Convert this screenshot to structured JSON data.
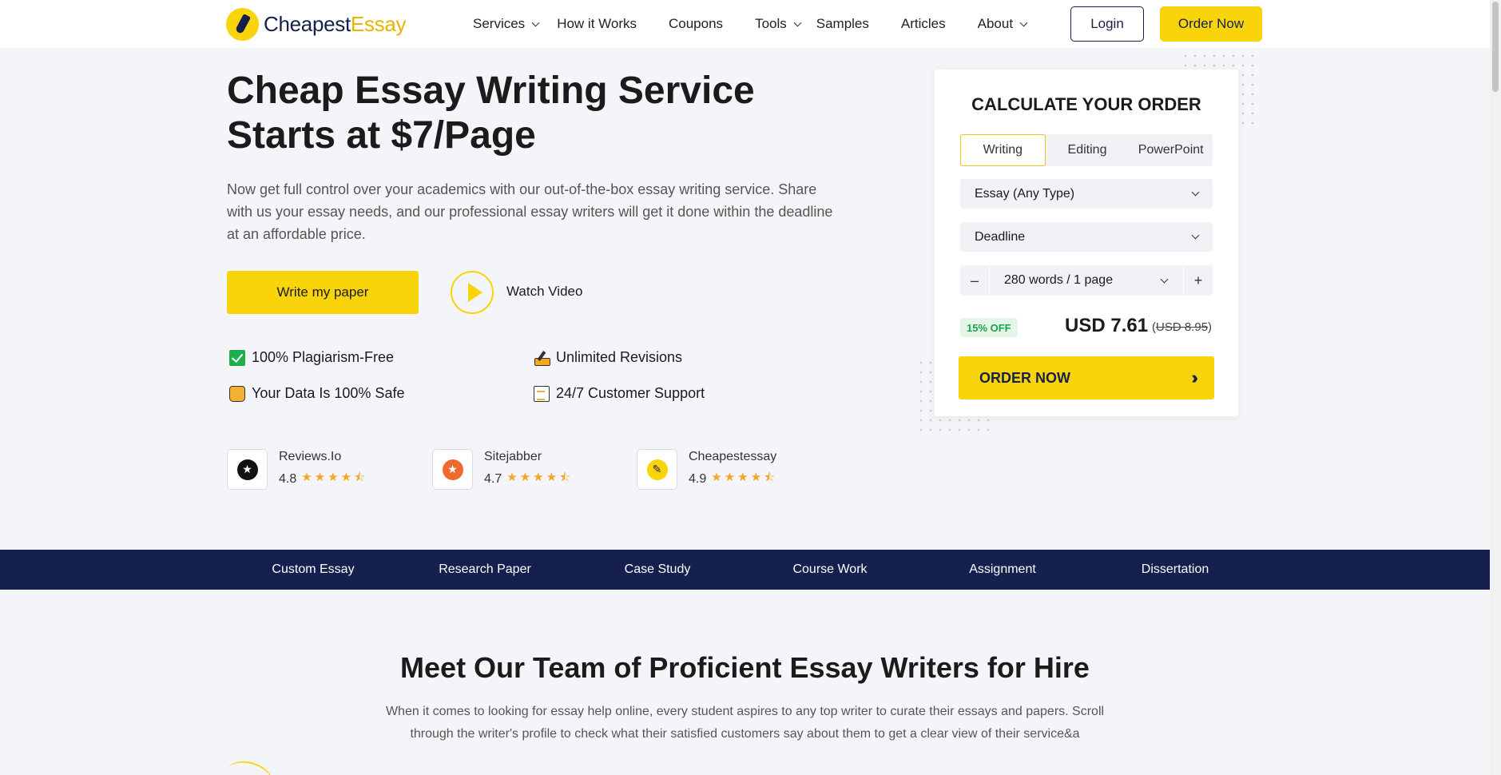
{
  "header": {
    "logo_part1": "Cheapest",
    "logo_part2": "Essay",
    "nav": [
      {
        "label": "Services",
        "dropdown": true
      },
      {
        "label": "How it Works",
        "dropdown": false
      },
      {
        "label": "Coupons",
        "dropdown": false
      },
      {
        "label": "Tools",
        "dropdown": true
      },
      {
        "label": "Samples",
        "dropdown": false
      },
      {
        "label": "Articles",
        "dropdown": false
      },
      {
        "label": "About",
        "dropdown": true
      }
    ],
    "login_label": "Login",
    "order_label": "Order Now"
  },
  "hero": {
    "title": "Cheap Essay Writing Service Starts at $7/Page",
    "description": "Now get full control over your academics with our out-of-the-box essay writing service. Share with us your essay needs, and our professional essay writers will get it done within the deadline at an affordable price.",
    "write_button": "Write my paper",
    "watch_video": "Watch Video",
    "features": [
      {
        "icon": "checkmark-icon",
        "label": "100% Plagiarism-Free"
      },
      {
        "icon": "pencil-edit-icon",
        "label": "Unlimited Revisions"
      },
      {
        "icon": "bag-lock-icon",
        "label": "Your Data Is 100% Safe"
      },
      {
        "icon": "clipboard-icon",
        "label": "24/7 Customer Support"
      }
    ],
    "ratings": [
      {
        "name": "Reviews.Io",
        "score": "4.8",
        "stars": 4.5,
        "icon": "star-badge-icon"
      },
      {
        "name": "Sitejabber",
        "score": "4.7",
        "stars": 4.5,
        "icon": "sitejabber-icon"
      },
      {
        "name": "Cheapestessay",
        "score": "4.9",
        "stars": 4.5,
        "icon": "cheapestessay-logo-icon"
      }
    ]
  },
  "calculator": {
    "title": "CALCULATE YOUR ORDER",
    "tabs": [
      "Writing",
      "Editing",
      "PowerPoint"
    ],
    "active_tab": "Writing",
    "paper_type": "Essay (Any Type)",
    "deadline": "Deadline",
    "pages_label": "280 words / 1 page",
    "minus": "–",
    "plus": "+",
    "discount": "15% OFF",
    "price": "USD 7.61",
    "old_price_open": "(",
    "old_price": "USD 8.95",
    "old_price_close": ")",
    "order_button": "ORDER NOW"
  },
  "categories": [
    "Custom Essay",
    "Research Paper",
    "Case Study",
    "Course Work",
    "Assignment",
    "Dissertation"
  ],
  "team": {
    "title": "Meet Our Team of Proficient Essay Writers for Hire",
    "description": "When it comes to looking for essay help online, every student aspires to any top writer to curate their essays and papers. Scroll through the writer's profile to check what their satisfied customers say about them to get a clear view of their service&a"
  },
  "colors": {
    "accent_yellow": "#f9d40a",
    "navy": "#15204e",
    "background": "#f3f5f8",
    "discount_green": "#1aa34a",
    "star_orange": "#f4a623"
  }
}
